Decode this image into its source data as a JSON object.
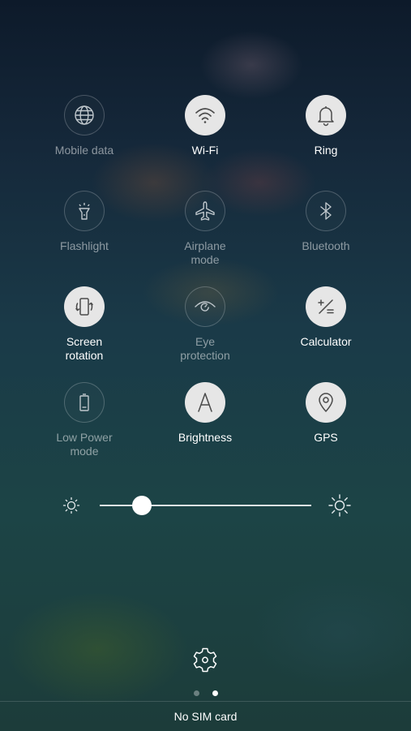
{
  "quick_settings": {
    "tiles": [
      {
        "label": "Mobile data",
        "icon": "globe-icon",
        "state": "off"
      },
      {
        "label": "Wi-Fi",
        "icon": "wifi-icon",
        "state": "on"
      },
      {
        "label": "Ring",
        "icon": "bell-icon",
        "state": "on"
      },
      {
        "label": "Flashlight",
        "icon": "flashlight-icon",
        "state": "off"
      },
      {
        "label": "Airplane\nmode",
        "icon": "airplane-icon",
        "state": "off"
      },
      {
        "label": "Bluetooth",
        "icon": "bluetooth-icon",
        "state": "off"
      },
      {
        "label": "Screen\nrotation",
        "icon": "screen-rotation-icon",
        "state": "on"
      },
      {
        "label": "Eye\nprotection",
        "icon": "eye-icon",
        "state": "off"
      },
      {
        "label": "Calculator",
        "icon": "calculator-icon",
        "state": "on"
      },
      {
        "label": "Low Power\nmode",
        "icon": "battery-icon",
        "state": "off"
      },
      {
        "label": "Brightness",
        "icon": "brightness-a-icon",
        "state": "on"
      },
      {
        "label": "GPS",
        "icon": "location-pin-icon",
        "state": "on"
      }
    ]
  },
  "brightness": {
    "level": 0.2,
    "low_icon": "sun-low-icon",
    "high_icon": "sun-high-icon"
  },
  "settings_icon": "gear-icon",
  "pager": {
    "pages": 2,
    "current": 2
  },
  "status": {
    "carrier": "No SIM card"
  },
  "colors": {
    "active_circle": "#e6e6e6",
    "active_icon": "#4a4a4a",
    "inactive_icon": "#bfc7cc"
  }
}
